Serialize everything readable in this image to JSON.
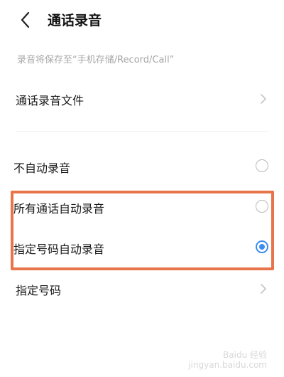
{
  "header": {
    "title": "通话录音",
    "back_icon": "chevron-left-icon"
  },
  "hint": "录音将保存至“手机存储/Record/Call”",
  "recording_files": {
    "label": "通话录音文件",
    "icon": "chevron-right-icon"
  },
  "options": [
    {
      "label": "不自动录音",
      "selected": false
    },
    {
      "label": "所有通话自动录音",
      "selected": false
    },
    {
      "label": "指定号码自动录音",
      "selected": true
    }
  ],
  "specified_numbers": {
    "label": "指定号码",
    "icon": "chevron-right-icon"
  },
  "colors": {
    "accent": "#3b8df0",
    "highlight_border": "#e8744a",
    "hint_text": "#a6a6a6"
  },
  "watermark": {
    "line1": "Baidu 经验",
    "line2": "jingyan.baidu.com"
  }
}
